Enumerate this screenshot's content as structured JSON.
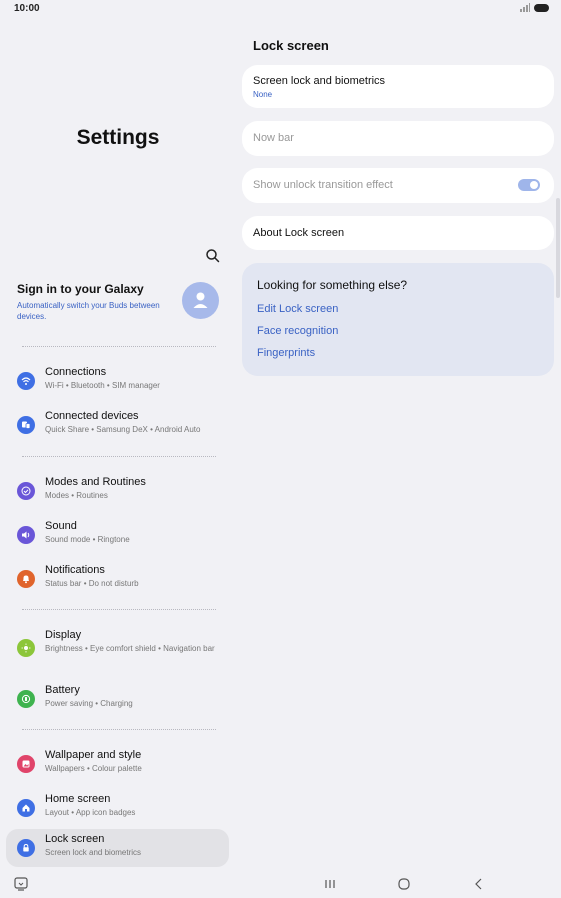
{
  "status": {
    "time": "10:00"
  },
  "settings": {
    "title": "Settings"
  },
  "account": {
    "title": "Sign in to your Galaxy",
    "subtitle": "Automatically switch your Buds between devices."
  },
  "menu": [
    {
      "label": "Connections",
      "sub": "Wi-Fi • Bluetooth • SIM manager",
      "icon": "wifi-icon",
      "color": "#3f6fe4"
    },
    {
      "label": "Connected devices",
      "sub": "Quick Share • Samsung DeX • Android Auto",
      "icon": "devices-icon",
      "color": "#3f6fe4"
    },
    {
      "label": "Modes and Routines",
      "sub": "Modes • Routines",
      "icon": "check-circle-icon",
      "color": "#6a56d8"
    },
    {
      "label": "Sound",
      "sub": "Sound mode • Ringtone",
      "icon": "speaker-icon",
      "color": "#6a56d8"
    },
    {
      "label": "Notifications",
      "sub": "Status bar • Do not disturb",
      "icon": "bell-icon",
      "color": "#e0642c"
    },
    {
      "label": "Display",
      "sub": "Brightness • Eye comfort shield • Navigation bar",
      "icon": "sun-icon",
      "color": "#8cc63a"
    },
    {
      "label": "Battery",
      "sub": "Power saving • Charging",
      "icon": "battery-icon",
      "color": "#3fb34f"
    },
    {
      "label": "Wallpaper and style",
      "sub": "Wallpapers • Colour palette",
      "icon": "image-icon",
      "color": "#e0446a"
    },
    {
      "label": "Home screen",
      "sub": "Layout • App icon badges",
      "icon": "home-icon",
      "color": "#3f6fe4"
    },
    {
      "label": "Lock screen",
      "sub": "Screen lock and biometrics",
      "icon": "lock-icon",
      "color": "#3f6fe4"
    }
  ],
  "lock_screen": {
    "title": "Lock screen",
    "screen_lock": {
      "label": "Screen lock and biometrics",
      "value": "None"
    },
    "now_bar": {
      "label": "Now bar"
    },
    "unlock_effect": {
      "label": "Show unlock transition effect",
      "on": true
    },
    "about": {
      "label": "About Lock screen"
    }
  },
  "suggestions": {
    "title": "Looking for something else?",
    "links": [
      "Edit Lock screen",
      "Face recognition",
      "Fingerprints"
    ]
  },
  "colors": {
    "accent": "#3a62c4",
    "background": "#f1f1f5",
    "card": "#ffffff",
    "suggest": "#e2e6f2"
  }
}
